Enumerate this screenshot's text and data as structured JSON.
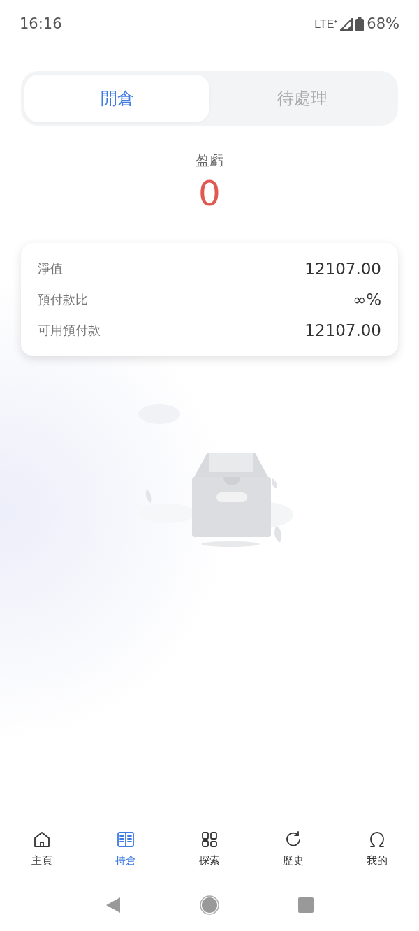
{
  "status_bar": {
    "time": "16:16",
    "network": "LTE⁺",
    "battery": "68%"
  },
  "tabs": [
    {
      "label": "開倉",
      "selected": true
    },
    {
      "label": "待處理",
      "selected": false
    }
  ],
  "pnl": {
    "label": "盈虧",
    "value": "0"
  },
  "summary": [
    {
      "label": "淨值",
      "value": "12107.00"
    },
    {
      "label": "預付款比",
      "value": "∞%"
    },
    {
      "label": "可用預付款",
      "value": "12107.00"
    }
  ],
  "bottom_nav": [
    {
      "kind": "home",
      "label": "主頁",
      "selected": false
    },
    {
      "kind": "book",
      "label": "持倉",
      "selected": true
    },
    {
      "kind": "grid",
      "label": "探索",
      "selected": false
    },
    {
      "kind": "refresh",
      "label": "歷史",
      "selected": false
    },
    {
      "kind": "person",
      "label": "我的",
      "selected": false
    }
  ]
}
